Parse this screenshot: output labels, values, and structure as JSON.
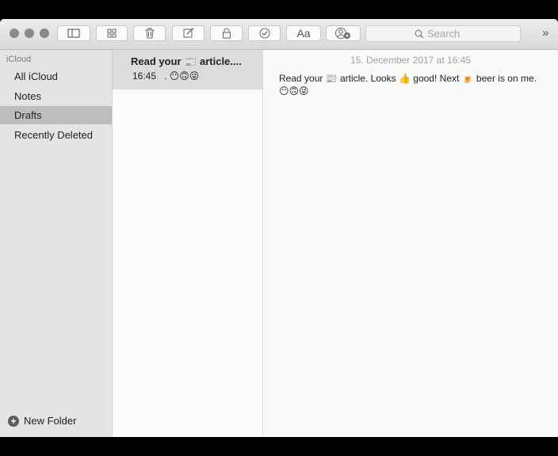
{
  "toolbar": {
    "font_button_label": "Aa",
    "search_placeholder": "Search",
    "overflow_label": "»"
  },
  "sidebar": {
    "section_header": "iCloud",
    "items": [
      {
        "label": "All iCloud"
      },
      {
        "label": "Notes"
      },
      {
        "label": "Drafts",
        "selected": true
      },
      {
        "label": "Recently Deleted"
      }
    ],
    "new_folder_label": "New Folder"
  },
  "notes_list": {
    "items": [
      {
        "title": "Read your 📰 article....",
        "time": "16:45",
        "preview": ". 😶🙃😜"
      }
    ]
  },
  "editor": {
    "date": "15. December 2017 at 16:45",
    "body": "Read your 📰 article. Looks 👍 good! Next 🍺 beer is on me. 😶🙃😜"
  },
  "colors": {
    "sidebar_bg": "#e4e4e4",
    "selected_row": "#bdbdbd",
    "toolbar_bg": "#dedede"
  }
}
